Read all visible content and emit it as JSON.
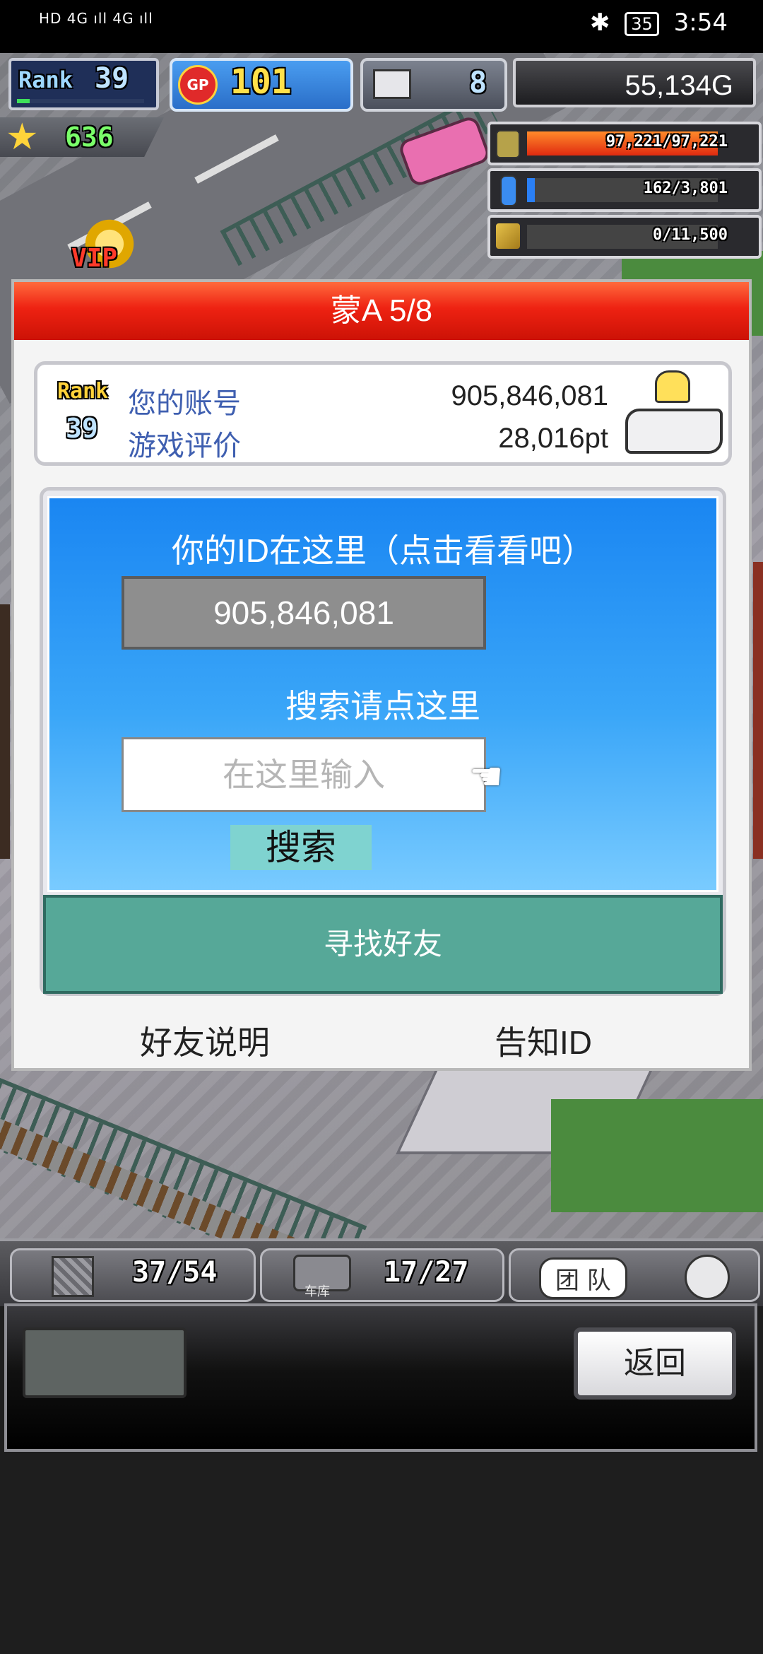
{
  "status_bar": {
    "left_indicators": "HD 4G ıll 4G ıll",
    "battery": "35",
    "time": "3:54"
  },
  "hud": {
    "rank_label": "Rank",
    "rank_value": "39",
    "gp_label": "GP",
    "gp_value": "101",
    "computer_value": "8",
    "gold": "55,134G",
    "star_value": "636",
    "resource1": "97,221/97,221",
    "resource2": "162/3,801",
    "resource3": "0/11,500",
    "vip_label": "VIP",
    "resource1_fill": 1.0,
    "resource2_fill": 0.04,
    "resource3_fill": 0.0
  },
  "dialog": {
    "title": "蒙A 5/8",
    "profile": {
      "rank_label": "Rank",
      "rank_value": "39",
      "account_label": "您的账号",
      "account_value": "905,846,081",
      "rating_label": "游戏评价",
      "rating_value": "28,016pt"
    },
    "id_prompt": "你的ID在这里（点击看看吧）",
    "id_value": "905,846,081",
    "search_prompt": "搜索请点这里",
    "search_placeholder": "在这里输入",
    "search_button": "搜索",
    "find_friend_button": "寻找好友",
    "friend_help_link": "好友说明",
    "notify_id_link": "告知ID"
  },
  "bottom_bar": {
    "count1": "37/54",
    "garage_label": "车库",
    "count2": "17/27",
    "team_label": "团 队",
    "back_button": "返回"
  },
  "colors": {
    "title_red": "#e8200f",
    "find_friend_teal": "#56a898",
    "search_button_cyan": "#7fd3d0",
    "label_blue": "#3f5fb0"
  }
}
